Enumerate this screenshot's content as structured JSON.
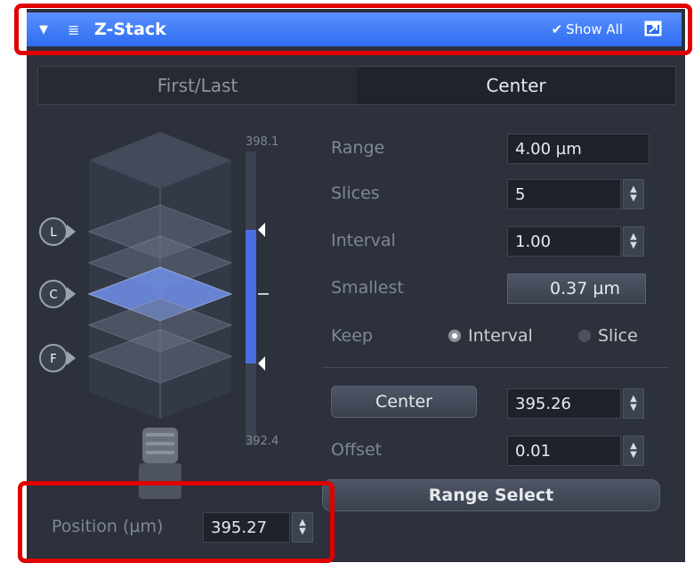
{
  "window": {
    "title": "Z-Stack",
    "show_all_label": "Show All",
    "icons": [
      "collapse-arrow-icon",
      "grip-icon",
      "check-icon",
      "external-window-icon"
    ]
  },
  "tabs": [
    {
      "label": "First/Last",
      "active": false
    },
    {
      "label": "Center",
      "active": true
    }
  ],
  "scale": {
    "top_label": "398.1",
    "bottom_label": "392.4"
  },
  "markers": [
    "L",
    "C",
    "F"
  ],
  "params": {
    "range_label": "Range",
    "range_value": "4.00 µm",
    "slices_label": "Slices",
    "slices_value": "5",
    "interval_label": "Interval",
    "interval_value": "1.00",
    "smallest_label": "Smallest",
    "smallest_value": "0.37 µm",
    "keep_label": "Keep",
    "keep_options": [
      {
        "label": "Interval",
        "selected": true
      },
      {
        "label": "Slice",
        "selected": false
      }
    ]
  },
  "center": {
    "button_label": "Center",
    "value": "395.26",
    "offset_label": "Offset",
    "offset_value": "0.01",
    "range_select_label": "Range Select"
  },
  "position": {
    "label": "Position (µm)",
    "value": "395.27"
  },
  "colors": {
    "titlebar": "#3a78f5",
    "panel": "#2c313c",
    "accent_blue": "#4a6fe0",
    "annotation": "#e00000"
  }
}
